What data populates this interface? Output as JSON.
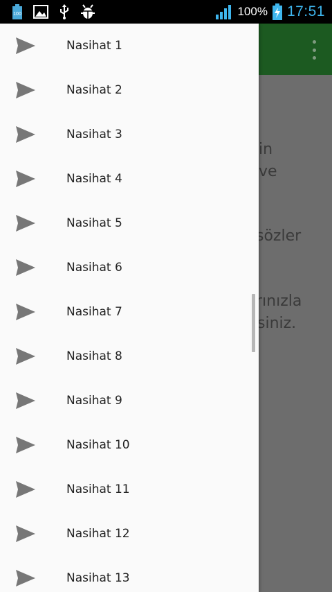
{
  "status_bar": {
    "battery_percent": "100%",
    "time": "17:51",
    "time_color": "#3fb6ee",
    "left_icons": [
      "battery-100-icon",
      "image-icon",
      "usb-icon",
      "android-debug-icon"
    ],
    "right_icons": [
      "signal-icon",
      "battery-charging-icon"
    ]
  },
  "app": {
    "toolbar_color": "#1c5a21",
    "background_text_fragments": [
      "in",
      "ve",
      "sözler",
      "rınızla",
      "siniz."
    ]
  },
  "drawer": {
    "items": [
      {
        "label": "Nasihat 1",
        "icon": "send-icon"
      },
      {
        "label": "Nasihat 2",
        "icon": "send-icon"
      },
      {
        "label": "Nasihat 3",
        "icon": "send-icon"
      },
      {
        "label": "Nasihat 4",
        "icon": "send-icon"
      },
      {
        "label": "Nasihat 5",
        "icon": "send-icon"
      },
      {
        "label": "Nasihat 6",
        "icon": "send-icon"
      },
      {
        "label": "Nasihat 7",
        "icon": "send-icon"
      },
      {
        "label": "Nasihat 8",
        "icon": "send-icon"
      },
      {
        "label": "Nasihat 9",
        "icon": "send-icon"
      },
      {
        "label": "Nasihat 10",
        "icon": "send-icon"
      },
      {
        "label": "Nasihat 11",
        "icon": "send-icon"
      },
      {
        "label": "Nasihat 12",
        "icon": "send-icon"
      },
      {
        "label": "Nasihat 13",
        "icon": "send-icon"
      }
    ]
  }
}
